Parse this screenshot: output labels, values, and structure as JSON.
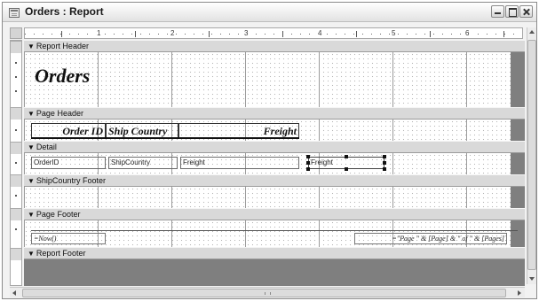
{
  "window": {
    "title": "Orders : Report"
  },
  "ruler": {
    "numbers": [
      "1",
      "2",
      "3",
      "4",
      "5",
      "6"
    ]
  },
  "sections": {
    "report_header": "Report Header",
    "page_header": "Page Header",
    "detail": "Detail",
    "group_footer": "ShipCountry Footer",
    "page_footer": "Page Footer",
    "report_footer": "Report Footer"
  },
  "controls": {
    "report_title": "Orders",
    "label_order_id": "Order ID",
    "label_ship_country": "Ship Country",
    "label_freight": "Freight",
    "field_order_id": "OrderID",
    "field_ship_country": "ShipCountry",
    "field_freight": "Freight",
    "field_freight_selected": "Freight",
    "footer_now": "=Now()",
    "footer_page": "=\"Page \" & [Page] & \" of \" & [Pages]"
  },
  "colors": {
    "design_gray": "#7f7f7f",
    "section_bar": "#d9d9d9",
    "grid_white": "#ffffff"
  }
}
